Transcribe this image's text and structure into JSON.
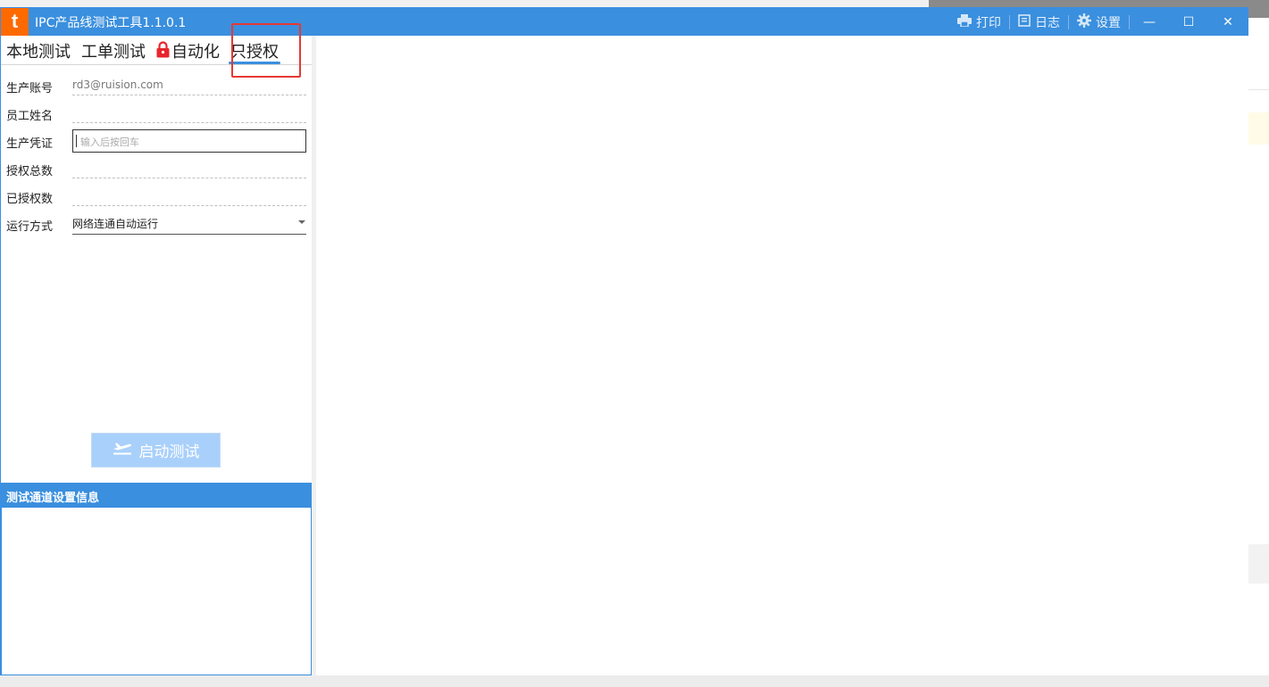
{
  "window": {
    "title": "IPC产品线测试工具1.1.0.1",
    "logo_char": "t",
    "actions": {
      "print": "打印",
      "log": "日志",
      "settings": "设置"
    },
    "controls": {
      "minimize": "—",
      "maximize": "☐",
      "close": "✕"
    }
  },
  "tabs": [
    {
      "label": "本地测试",
      "active": false
    },
    {
      "label": "工单测试",
      "active": false
    },
    {
      "label": "自动化",
      "active": false,
      "locked": true
    },
    {
      "label": "只授权",
      "active": true
    }
  ],
  "form": {
    "account": {
      "label": "生产账号",
      "value": "rd3@ruision.com"
    },
    "employee": {
      "label": "员工姓名",
      "value": ""
    },
    "credential": {
      "label": "生产凭证",
      "placeholder": "输入后按回车"
    },
    "total": {
      "label": "授权总数",
      "value": ""
    },
    "authorized": {
      "label": "已授权数",
      "value": ""
    },
    "run_mode": {
      "label": "运行方式",
      "selected": "网络连通自动运行"
    }
  },
  "start_button": {
    "label": "启动测试"
  },
  "channel_panel": {
    "title": "测试通道设置信息"
  },
  "colors": {
    "titlebar": "#3a8fde",
    "logo": "#ff6a00",
    "lock": "#e8262d",
    "highlight": "#e53935",
    "start_button": "#a9d0fb"
  }
}
